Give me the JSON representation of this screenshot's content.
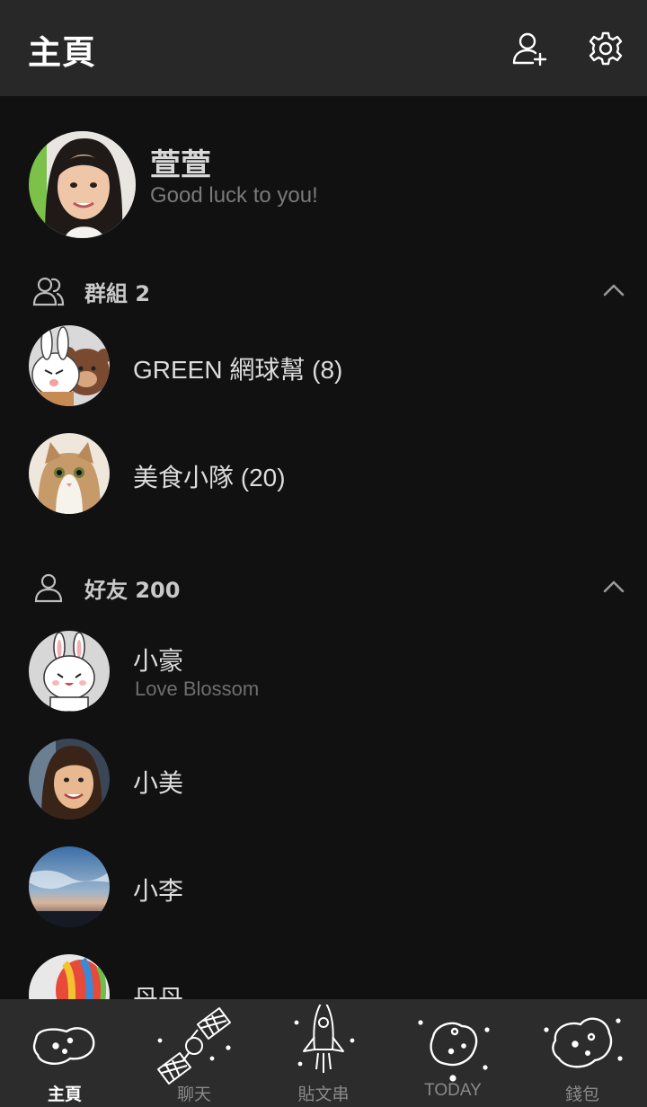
{
  "header": {
    "title": "主頁"
  },
  "profile": {
    "name": "萱萱",
    "status": "Good luck to you!"
  },
  "groups": {
    "label": "群組 2",
    "items": [
      {
        "name": "GREEN 網球幫 (8)"
      },
      {
        "name": "美食小隊 (20)"
      }
    ]
  },
  "friends": {
    "label": "好友 200",
    "items": [
      {
        "name": "小豪",
        "status": "Love Blossom"
      },
      {
        "name": "小美"
      },
      {
        "name": "小李"
      },
      {
        "name": "丹丹"
      }
    ]
  },
  "tabs": [
    {
      "label": "主頁",
      "icon": "asteroid-icon",
      "active": true
    },
    {
      "label": "聊天",
      "icon": "satellite-icon"
    },
    {
      "label": "貼文串",
      "icon": "rocket-icon"
    },
    {
      "label": "TODAY",
      "icon": "asteroid-icon"
    },
    {
      "label": "錢包",
      "icon": "asteroid-icon"
    }
  ],
  "colors": {
    "background": "#111112",
    "header": "#282828",
    "tabbar": "#2c2c2c",
    "text": "#e6e6e6",
    "muted": "#7a7a7a"
  }
}
